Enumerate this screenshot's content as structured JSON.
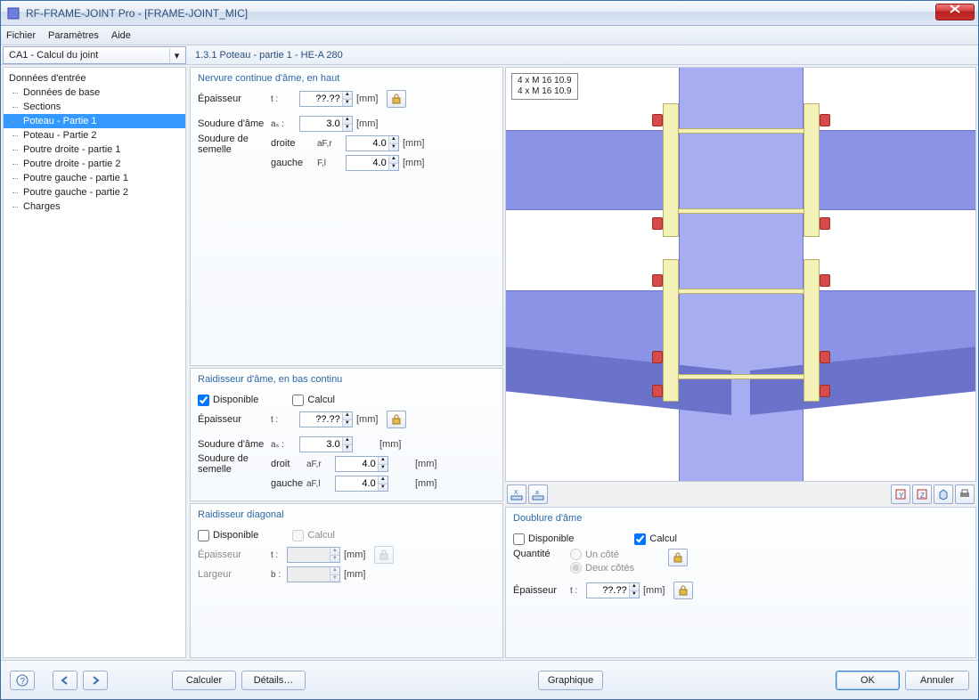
{
  "window": {
    "title": "RF-FRAME-JOINT Pro - [FRAME-JOINT_MIC]"
  },
  "menu": {
    "file": "Fichier",
    "params": "Paramètres",
    "help": "Aide"
  },
  "combo": {
    "value": "CA1 - Calcul du joint"
  },
  "header": {
    "path": "1.3.1 Poteau - partie 1 - HE-A 280"
  },
  "tree": {
    "root": "Données d'entrée",
    "items": [
      "Données de base",
      "Sections",
      "Poteau - Partie 1",
      "Poteau - Partie 2",
      "Poutre droite - partie 1",
      "Poutre droite - partie 2",
      "Poutre gauche - partie 1",
      "Poutre gauche - partie 2",
      "Charges"
    ],
    "selected_index": 2
  },
  "group1": {
    "title": "Nervure continue d'âme, en haut",
    "thickness_label": "Épaisseur",
    "thickness_sym": "t :",
    "thickness_val": "??.??",
    "unit": "[mm]",
    "weld_web": "Soudure d'âme",
    "weld_fl": "Soudure de semelle",
    "as_sym": "aₛ :",
    "as_val": "3.0",
    "right_lbl": "droite",
    "afr_sym": "aF,r",
    "afr_val": "4.0",
    "left_lbl": "gauche",
    "afl_sym": "F,l",
    "afl_val": "4.0"
  },
  "group2": {
    "title": "Raidisseur d'âme, en bas continu",
    "disponible": "Disponible",
    "calcul": "Calcul",
    "thickness_label": "Épaisseur",
    "thickness_sym": "t :",
    "thickness_val": "??.??",
    "unit": "[mm]",
    "weld_web": "Soudure d'âme",
    "as_sym": "aₛ :",
    "as_val": "3.0",
    "weld_fl": "Soudure de semelle",
    "right_lbl": "droit",
    "afr_sym": "aF,r",
    "afr_val": "4.0",
    "left_lbl": "gauche",
    "afl_sym": "aF,l",
    "afl_val": "4.0"
  },
  "group3": {
    "title": "Raidisseur diagonal",
    "disponible": "Disponible",
    "calcul": "Calcul",
    "thickness_label": "Épaisseur",
    "width_label": "Largeur",
    "thickness_sym": "t :",
    "width_sym": "b :",
    "unit": "[mm]"
  },
  "preview": {
    "bolt1": "4 x M 16 10.9",
    "bolt2": "4 x M 16 10.9"
  },
  "doublure": {
    "title": "Doublure d'âme",
    "disponible": "Disponible",
    "calcul": "Calcul",
    "qty": "Quantité",
    "one": "Un côté",
    "two": "Deux côtés",
    "thickness_label": "Épaisseur",
    "thickness_sym": "t :",
    "thickness_val": "??.??",
    "unit": "[mm]"
  },
  "footer": {
    "calc": "Calculer",
    "details": "Détails…",
    "graph": "Graphique",
    "ok": "OK",
    "cancel": "Annuler"
  }
}
